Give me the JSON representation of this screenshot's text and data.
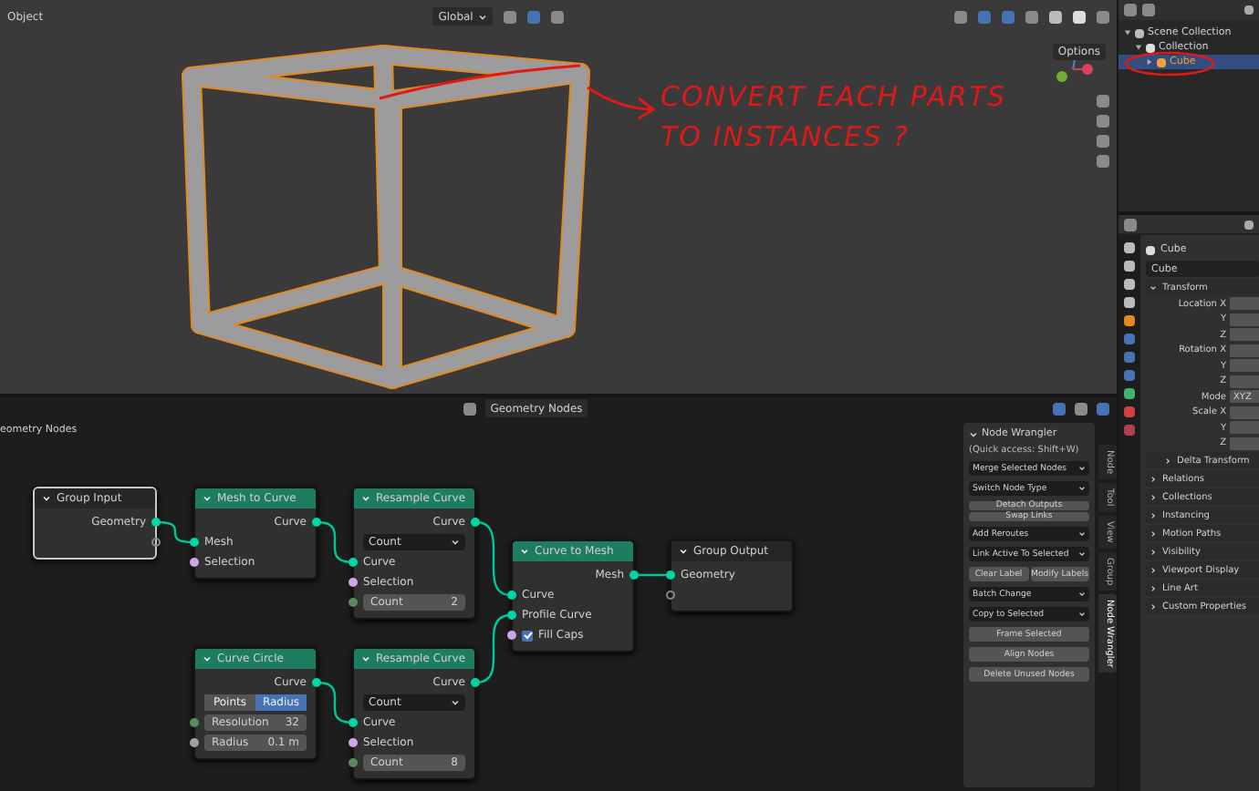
{
  "viewport": {
    "mode": "Object",
    "orientation": "Global",
    "options": "Options",
    "annotation": [
      "CONVERT EACH PARTS",
      "TO INSTANCES ?"
    ]
  },
  "outliner": {
    "tree": [
      {
        "label": "Scene Collection",
        "selected": false,
        "children": [
          {
            "label": "Collection",
            "selected": false,
            "children": [
              {
                "label": "Cube",
                "selected": true
              }
            ]
          }
        ]
      }
    ]
  },
  "properties": {
    "object_name": "Cube",
    "data_name": "Cube",
    "sections": [
      {
        "kind": "panel",
        "label": "Transform",
        "expanded": true,
        "rows": [
          {
            "label": "Location X"
          },
          {
            "label": "Y"
          },
          {
            "label": "Z"
          },
          {
            "label": "Rotation X"
          },
          {
            "label": "Y"
          },
          {
            "label": "Z"
          },
          {
            "label": "Mode",
            "value": "XYZ"
          },
          {
            "label": "Scale X"
          },
          {
            "label": "Y"
          },
          {
            "label": "Z"
          }
        ]
      },
      {
        "kind": "subpanel",
        "label": "Delta Transform",
        "expanded": false
      },
      {
        "kind": "panel",
        "label": "Relations",
        "expanded": false
      },
      {
        "kind": "panel",
        "label": "Collections",
        "expanded": false
      },
      {
        "kind": "panel",
        "label": "Instancing",
        "expanded": false
      },
      {
        "kind": "panel",
        "label": "Motion Paths",
        "expanded": false
      },
      {
        "kind": "panel",
        "label": "Visibility",
        "expanded": false
      },
      {
        "kind": "panel",
        "label": "Viewport Display",
        "expanded": false
      },
      {
        "kind": "panel",
        "label": "Line Art",
        "expanded": false
      },
      {
        "kind": "panel",
        "label": "Custom Properties",
        "expanded": false
      }
    ]
  },
  "node_editor": {
    "tree_name": "Geometry Nodes",
    "breadcrumb": "eometry Nodes",
    "nodes": [
      {
        "kind": "group",
        "title": "Group Input",
        "rows": [
          {
            "kind": "output",
            "label": "Geometry",
            "color": "#00d6a3"
          },
          {
            "kind": "output_empty"
          }
        ]
      },
      {
        "kind": "geometry",
        "title": "Mesh to Curve",
        "rows": [
          {
            "kind": "output",
            "label": "Curve",
            "color": "#00d6a3"
          },
          {
            "kind": "input",
            "label": "Mesh",
            "color": "#00d6a3"
          },
          {
            "kind": "input",
            "label": "Selection",
            "color": "#cca6e8"
          }
        ]
      },
      {
        "kind": "geometry",
        "title": "Resample Curve",
        "rows": [
          {
            "kind": "output",
            "label": "Curve",
            "color": "#00d6a3"
          },
          {
            "kind": "dropdown",
            "value": "Count"
          },
          {
            "kind": "input",
            "label": "Curve",
            "color": "#00d6a3"
          },
          {
            "kind": "input",
            "label": "Selection",
            "color": "#cca6e8"
          },
          {
            "kind": "field",
            "label": "Count",
            "value": "2",
            "color": "#598c5c"
          }
        ]
      },
      {
        "kind": "geometry",
        "title": "Curve to Mesh",
        "rows": [
          {
            "kind": "output",
            "label": "Mesh",
            "color": "#00d6a3"
          },
          {
            "kind": "input",
            "label": "Curve",
            "color": "#00d6a3"
          },
          {
            "kind": "input",
            "label": "Profile Curve",
            "color": "#00d6a3"
          },
          {
            "kind": "checkbox",
            "label": "Fill Caps",
            "checked": true,
            "color": "#cca6e8"
          }
        ]
      },
      {
        "kind": "group",
        "title": "Group Output",
        "rows": [
          {
            "kind": "input",
            "label": "Geometry",
            "color": "#00d6a3"
          },
          {
            "kind": "input_empty"
          }
        ]
      },
      {
        "kind": "geometry",
        "title": "Curve Circle",
        "rows": [
          {
            "kind": "output",
            "label": "Curve",
            "color": "#00d6a3"
          },
          {
            "kind": "toggle",
            "options": [
              {
                "label": "Points",
                "selected": false
              },
              {
                "label": "Radius",
                "selected": true
              }
            ]
          },
          {
            "kind": "field",
            "label": "Resolution",
            "value": "32",
            "color": "#598c5c"
          },
          {
            "kind": "field",
            "label": "Radius",
            "value": "0.1 m",
            "color": "#a1a1a1"
          }
        ]
      },
      {
        "kind": "geometry",
        "title": "Resample Curve",
        "rows": [
          {
            "kind": "output",
            "label": "Curve",
            "color": "#00d6a3"
          },
          {
            "kind": "dropdown",
            "value": "Count"
          },
          {
            "kind": "input",
            "label": "Curve",
            "color": "#00d6a3"
          },
          {
            "kind": "input",
            "label": "Selection",
            "color": "#cca6e8"
          },
          {
            "kind": "field",
            "label": "Count",
            "value": "8",
            "color": "#598c5c"
          }
        ]
      }
    ],
    "sidebar": {
      "title": "Node Wrangler",
      "hint": "(Quick access: Shift+W)",
      "items": [
        {
          "kind": "dropdown",
          "label": "Merge Selected Nodes"
        },
        {
          "kind": "dropdown",
          "label": "Switch Node Type"
        },
        {
          "kind": "stack",
          "labels": [
            "Detach Outputs",
            "Swap Links"
          ]
        },
        {
          "kind": "dropdown",
          "label": "Add Reroutes"
        },
        {
          "kind": "dropdown",
          "label": "Link Active To Selected"
        },
        {
          "kind": "pair",
          "labels": [
            "Clear Label",
            "Modify Labels"
          ]
        },
        {
          "kind": "dropdown",
          "label": "Batch Change"
        },
        {
          "kind": "dropdown",
          "label": "Copy to Selected"
        },
        {
          "kind": "button",
          "label": "Frame Selected"
        },
        {
          "kind": "button",
          "label": "Align Nodes"
        },
        {
          "kind": "button",
          "label": "Delete Unused Nodes"
        }
      ]
    },
    "tabs": [
      {
        "label": "Node",
        "selected": false
      },
      {
        "label": "Tool",
        "selected": false
      },
      {
        "label": "View",
        "selected": false
      },
      {
        "label": "Group",
        "selected": false
      },
      {
        "label": "Node Wrangler",
        "selected": true
      }
    ]
  }
}
